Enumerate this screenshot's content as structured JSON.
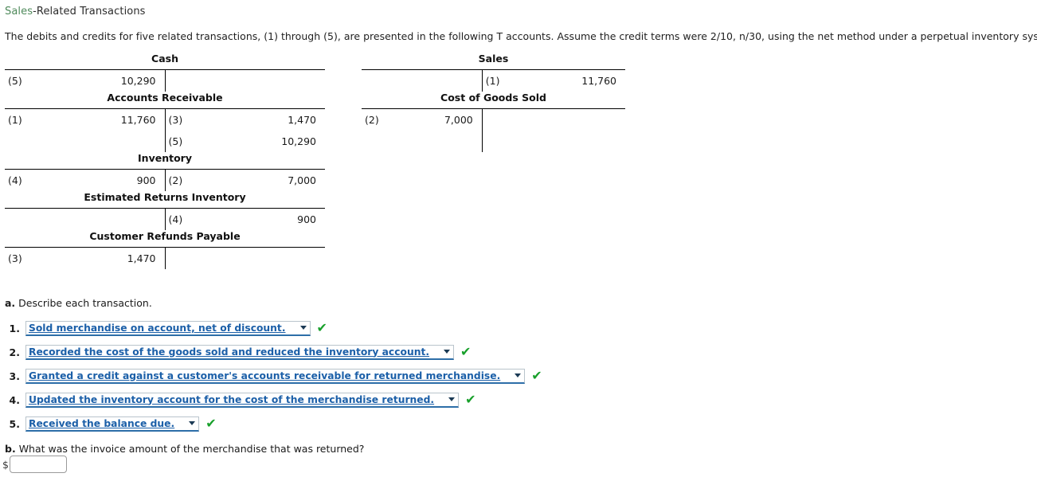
{
  "header": {
    "title_highlight": "Sales",
    "title_rest": "-Related Transactions",
    "intro": "The debits and credits for five related transactions, (1) through (5), are presented in the following T accounts. Assume the credit terms were 2/10, n/30, using the net method under a perpetual inventory system."
  },
  "colors": {
    "title_green": "#4f8a5b",
    "link_blue": "#1b5fa8",
    "check_green": "#18a02b",
    "rule_black": "#000000"
  },
  "t_accounts_left": [
    {
      "title": "Cash",
      "rows": [
        {
          "debit_ref": "(5)",
          "debit_amt": "10,290",
          "credit_ref": "",
          "credit_amt": ""
        }
      ]
    },
    {
      "title": "Accounts Receivable",
      "rows": [
        {
          "debit_ref": "(1)",
          "debit_amt": "11,760",
          "credit_ref": "(3)",
          "credit_amt": "1,470"
        },
        {
          "debit_ref": "",
          "debit_amt": "",
          "credit_ref": "(5)",
          "credit_amt": "10,290"
        }
      ]
    },
    {
      "title": "Inventory",
      "rows": [
        {
          "debit_ref": "(4)",
          "debit_amt": "900",
          "credit_ref": "(2)",
          "credit_amt": "7,000"
        }
      ]
    },
    {
      "title": "Estimated Returns Inventory",
      "rows": [
        {
          "debit_ref": "",
          "debit_amt": "",
          "credit_ref": "(4)",
          "credit_amt": "900"
        }
      ]
    },
    {
      "title": "Customer Refunds Payable",
      "rows": [
        {
          "debit_ref": "(3)",
          "debit_amt": "1,470",
          "credit_ref": "",
          "credit_amt": ""
        }
      ]
    }
  ],
  "t_accounts_right": [
    {
      "title": "Sales",
      "rows": [
        {
          "debit_ref": "",
          "debit_amt": "",
          "credit_ref": "(1)",
          "credit_amt": "11,760"
        }
      ]
    },
    {
      "title": "Cost of Goods Sold",
      "rows": [
        {
          "debit_ref": "(2)",
          "debit_amt": "7,000",
          "credit_ref": "",
          "credit_amt": ""
        },
        {
          "debit_ref": "",
          "debit_amt": "",
          "credit_ref": "",
          "credit_amt": ""
        }
      ]
    }
  ],
  "part_a": {
    "label": "a.",
    "prompt": "Describe each transaction.",
    "items": [
      {
        "num": "1.",
        "value": "Sold merchandise on account, net of discount.",
        "correct": true,
        "check": "✔"
      },
      {
        "num": "2.",
        "value": "Recorded the cost of the goods sold and reduced the inventory account.",
        "correct": true,
        "check": "✔"
      },
      {
        "num": "3.",
        "value": "Granted a credit against a customer's accounts receivable for returned merchandise.",
        "correct": true,
        "check": "✔"
      },
      {
        "num": "4.",
        "value": "Updated the inventory account for the cost of the merchandise returned.",
        "correct": true,
        "check": "✔"
      },
      {
        "num": "5.",
        "value": "Received the balance due.",
        "correct": true,
        "check": "✔"
      }
    ]
  },
  "part_b": {
    "label": "b.",
    "prompt": "What was the invoice amount of the merchandise that was returned?",
    "currency_symbol": "$",
    "input_value": "",
    "input_placeholder": ""
  }
}
